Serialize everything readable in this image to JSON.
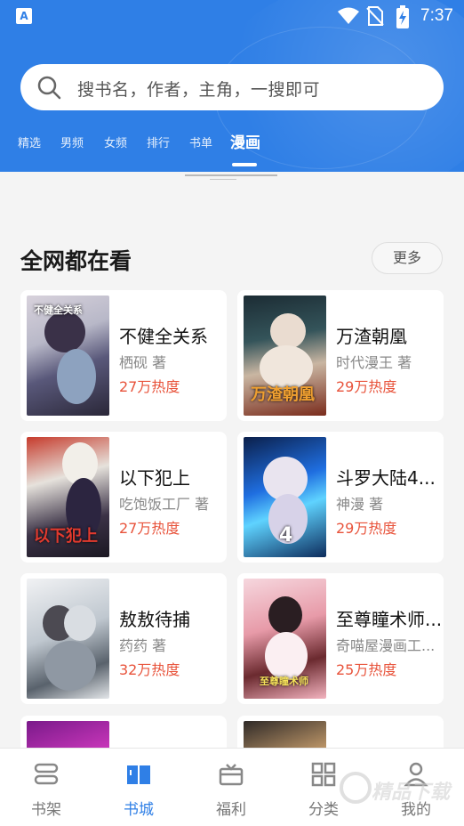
{
  "status_bar": {
    "app_badge": "A",
    "time": "7:37"
  },
  "search": {
    "placeholder": "搜书名，作者，主角，一搜即可"
  },
  "tabs": [
    "精选",
    "男频",
    "女频",
    "排行",
    "书单",
    "漫画"
  ],
  "active_tab": "漫画",
  "section": {
    "title": "全网都在看",
    "more_label": "更多"
  },
  "books": [
    {
      "title": "不健全关系",
      "author": "栖砚 著",
      "heat": "27万热度",
      "cover_text": "不健全关系"
    },
    {
      "title": "万渣朝凰",
      "author": "时代漫王 著",
      "heat": "29万热度",
      "cover_text": "万渣朝凰"
    },
    {
      "title": "以下犯上",
      "author": "吃饱饭工厂 著",
      "heat": "27万热度",
      "cover_text": "以下犯上"
    },
    {
      "title": "斗罗大陆4...",
      "author": "神漫 著",
      "heat": "29万热度",
      "cover_text": "4"
    },
    {
      "title": "敖敖待捕",
      "author": "药药 著",
      "heat": "32万热度",
      "cover_text": ""
    },
    {
      "title": "至尊瞳术师...",
      "author": "奇喵屋漫画工...",
      "heat": "25万热度",
      "cover_text": "至尊瞳术师"
    }
  ],
  "bottom_nav": [
    {
      "label": "书架",
      "icon": "bookshelf-icon"
    },
    {
      "label": "书城",
      "icon": "bookstore-icon"
    },
    {
      "label": "福利",
      "icon": "gift-icon"
    },
    {
      "label": "分类",
      "icon": "category-icon"
    },
    {
      "label": "我的",
      "icon": "profile-icon"
    }
  ],
  "active_nav": "书城",
  "watermark": "精品下载",
  "colors": {
    "brand_blue": "#2f7fe6",
    "heat_red": "#e8533b"
  }
}
